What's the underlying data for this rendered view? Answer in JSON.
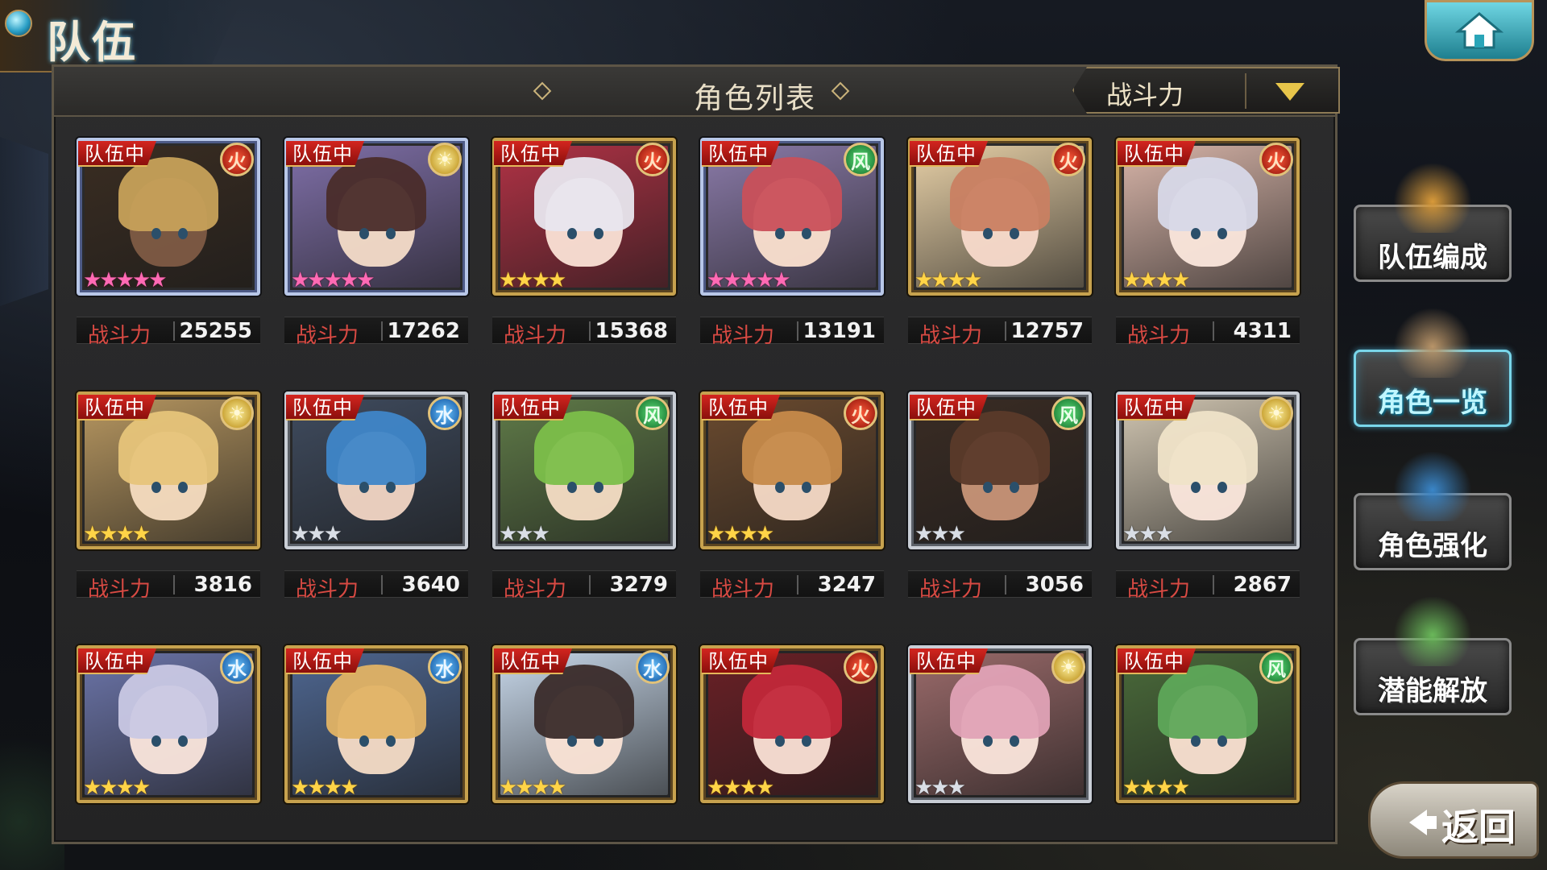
{
  "header": {
    "title": "队伍"
  },
  "panel": {
    "title": "角色列表",
    "sort_label": "战斗力"
  },
  "power_label": "战斗力",
  "team_badge": "队伍中",
  "characters": [
    {
      "element": "fire",
      "element_icon": "火",
      "stars": 5,
      "rarity": "rainbow",
      "power": "25255",
      "hair": "#c7a15a",
      "skin": "#7e5b45",
      "bg": "#3a2d22"
    },
    {
      "element": "light",
      "element_icon": "☀",
      "stars": 5,
      "rarity": "rainbow",
      "power": "17262",
      "hair": "#4a2c2a",
      "skin": "#f4dcc8",
      "bg": "#7f6fa8"
    },
    {
      "element": "fire",
      "element_icon": "火",
      "stars": 4,
      "rarity": "gold",
      "power": "15368",
      "hair": "#e8e6ee",
      "skin": "#fbe2d6",
      "bg": "#b03245"
    },
    {
      "element": "wind",
      "element_icon": "风",
      "stars": 5,
      "rarity": "rainbow",
      "power": "13191",
      "hair": "#c9505a",
      "skin": "#fbe0cf",
      "bg": "#8a7aa8"
    },
    {
      "element": "fire",
      "element_icon": "火",
      "stars": 4,
      "rarity": "gold",
      "power": "12757",
      "hair": "#c98062",
      "skin": "#f8dacb",
      "bg": "#e6cfa6"
    },
    {
      "element": "fire",
      "element_icon": "火",
      "stars": 4,
      "rarity": "gold",
      "power": "4311",
      "hair": "#d7d8e8",
      "skin": "#fbe7dc",
      "bg": "#d7b4a8"
    },
    {
      "element": "light",
      "element_icon": "☀",
      "stars": 4,
      "rarity": "gold",
      "power": "3816",
      "hair": "#e6c47a",
      "skin": "#f6dcc0",
      "bg": "#b69660"
    },
    {
      "element": "water",
      "element_icon": "水",
      "stars": 3,
      "rarity": "silver",
      "power": "3640",
      "hair": "#3f86c8",
      "skin": "#f2d6c4",
      "bg": "#3f4b5e"
    },
    {
      "element": "wind",
      "element_icon": "风",
      "stars": 3,
      "rarity": "silver",
      "power": "3279",
      "hair": "#7cbf4a",
      "skin": "#f6ddc5",
      "bg": "#5f7a48"
    },
    {
      "element": "fire",
      "element_icon": "火",
      "stars": 4,
      "rarity": "gold",
      "power": "3247",
      "hair": "#c68a4a",
      "skin": "#f6dac6",
      "bg": "#6a4a2f"
    },
    {
      "element": "wind",
      "element_icon": "风",
      "stars": 3,
      "rarity": "silver",
      "power": "3056",
      "hair": "#5b3a2a",
      "skin": "#c89578",
      "bg": "#3a2c24"
    },
    {
      "element": "light",
      "element_icon": "☀",
      "stars": 3,
      "rarity": "silver",
      "power": "2867",
      "hair": "#efe3c8",
      "skin": "#fbe7dc",
      "bg": "#cfc4b0"
    },
    {
      "element": "water",
      "element_icon": "水",
      "stars": 4,
      "rarity": "gold",
      "power": "",
      "hair": "#c9c8e4",
      "skin": "#fbe6dc",
      "bg": "#6b74a8"
    },
    {
      "element": "water",
      "element_icon": "水",
      "stars": 4,
      "rarity": "gold",
      "power": "",
      "hair": "#e1b365",
      "skin": "#f6dcc6",
      "bg": "#4e6690"
    },
    {
      "element": "water",
      "element_icon": "水",
      "stars": 4,
      "rarity": "gold",
      "power": "",
      "hair": "#3a2b2a",
      "skin": "#fbe4d6",
      "bg": "#c6d6e8"
    },
    {
      "element": "fire",
      "element_icon": "火",
      "stars": 4,
      "rarity": "gold",
      "power": "",
      "hair": "#c2283a",
      "skin": "#fbe2d6",
      "bg": "#6a2026"
    },
    {
      "element": "light",
      "element_icon": "☀",
      "stars": 3,
      "rarity": "silver",
      "power": "",
      "hair": "#e0a2b6",
      "skin": "#fbe6dc",
      "bg": "#9a6a6a"
    },
    {
      "element": "wind",
      "element_icon": "风",
      "stars": 4,
      "rarity": "gold",
      "power": "",
      "hair": "#5ea85a",
      "skin": "#fbe2d2",
      "bg": "#4a6a3a"
    }
  ],
  "side_menu": [
    {
      "id": "team-edit",
      "label": "队伍编成",
      "active": false
    },
    {
      "id": "char-list",
      "label": "角色一览",
      "active": true
    },
    {
      "id": "char-enhance",
      "label": "角色强化",
      "active": false
    },
    {
      "id": "potential",
      "label": "潜能解放",
      "active": false
    }
  ],
  "back_button": {
    "label": "返回"
  },
  "colors": {
    "badge_red": "#c81d1a",
    "frame_gold": "#c7a24e",
    "power_red": "#d84a43",
    "accent_cyan": "#79d6ea"
  }
}
